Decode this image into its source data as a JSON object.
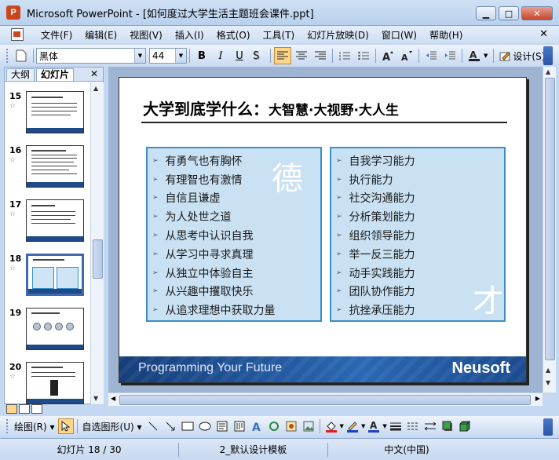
{
  "window": {
    "title": "Microsoft PowerPoint - [如何度过大学生活主题班会课件.ppt]",
    "app_icon_letter": "P",
    "minimize": "▁",
    "maximize": "□",
    "close": "✕"
  },
  "menu": {
    "items": [
      "文件(F)",
      "编辑(E)",
      "视图(V)",
      "插入(I)",
      "格式(O)",
      "工具(T)",
      "幻灯片放映(D)",
      "窗口(W)",
      "帮助(H)"
    ],
    "close": "✕"
  },
  "toolbar": {
    "font_name": "黑体",
    "font_size": "44",
    "bold": "B",
    "italic": "I",
    "underline": "U",
    "design_label": "设计(S)"
  },
  "left_pane": {
    "tabs": [
      "大纲",
      "幻灯片"
    ],
    "close": "✕",
    "slides": [
      {
        "num": "15",
        "star": "☆"
      },
      {
        "num": "16",
        "star": "☆"
      },
      {
        "num": "17",
        "star": "☆"
      },
      {
        "num": "18",
        "star": "☆"
      },
      {
        "num": "19",
        "star": ""
      },
      {
        "num": "20",
        "star": "☆"
      }
    ]
  },
  "slide": {
    "title_main": "大学到底学什么：",
    "title_sub": "大智慧·大视野·大人生",
    "left_items": [
      "有勇气也有胸怀",
      "有理智也有激情",
      "自信且谦虚",
      "为人处世之道",
      "从思考中认识自我",
      "从学习中寻求真理",
      "从独立中体验自主",
      "从兴趣中攫取快乐",
      "从追求理想中获取力量"
    ],
    "right_items": [
      "自我学习能力",
      "执行能力",
      "社交沟通能力",
      "分析策划能力",
      "组织领导能力",
      "举一反三能力",
      "动手实践能力",
      "团队协作能力",
      "抗挫承压能力"
    ],
    "left_watermark": "德",
    "right_watermark": "才",
    "bullet": "➢",
    "footer_slogan": "Programming Your Future",
    "footer_logo": "Neusoft"
  },
  "drawbar": {
    "draw_label": "绘图(R) ▾",
    "autoshapes_label": "自选图形(U) ▾"
  },
  "status": {
    "slide_pos": "幻灯片 18 / 30",
    "template": "2_默认设计模板",
    "language": "中文(中国)"
  }
}
